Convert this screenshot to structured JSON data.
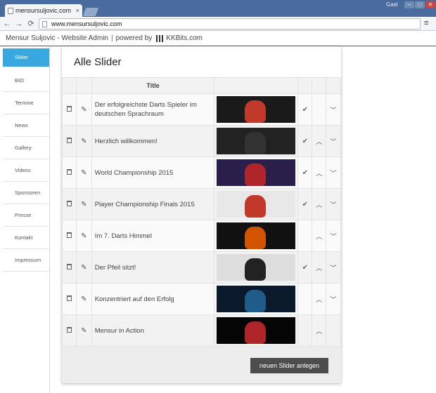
{
  "browser": {
    "tab_title": "mensursuljovic.com",
    "tab_close": "×",
    "user_label": "Gast",
    "url": "www.mensursuljovic.com",
    "back": "←",
    "forward": "→",
    "reload": "⟳",
    "menu": "≡",
    "win_min": "–",
    "win_max": "□",
    "win_close": "✕"
  },
  "site": {
    "name": "Mensur Suljovic - Website Admin",
    "powered": "powered by",
    "brand": "KKBits.com"
  },
  "sidebar": {
    "items": [
      {
        "label": "Slider",
        "active": true
      },
      {
        "label": "BIO"
      },
      {
        "label": "Termine"
      },
      {
        "label": "News"
      },
      {
        "label": "Gallery"
      },
      {
        "label": "Videos"
      },
      {
        "label": "Sponsoren"
      },
      {
        "label": "Presse"
      },
      {
        "label": "Kontakt"
      },
      {
        "label": "Impressum"
      }
    ]
  },
  "panel": {
    "title": "Alle Slider",
    "column_title": "Title",
    "new_button": "neuen Slider anlegen"
  },
  "slides": [
    {
      "title": "Der erfolgreichste Darts Spieler im deutschen Sprachraum",
      "active": true,
      "up": false,
      "down": true
    },
    {
      "title": "Herzlich willkommen!",
      "active": true,
      "up": true,
      "down": true
    },
    {
      "title": "World Championship 2015",
      "active": true,
      "up": true,
      "down": true
    },
    {
      "title": "Player Championship Finals 2015",
      "active": true,
      "up": true,
      "down": true
    },
    {
      "title": "Im 7. Darts Himmel",
      "active": false,
      "up": true,
      "down": true
    },
    {
      "title": "Der Pfeil sitzt!",
      "active": true,
      "up": true,
      "down": true
    },
    {
      "title": "Konzentriert auf den Erfolg",
      "active": false,
      "up": true,
      "down": true
    },
    {
      "title": "Mensur in Action",
      "active": false,
      "up": true,
      "down": false
    }
  ],
  "icons": {
    "check": "✔",
    "up": "︿",
    "down": "﹀",
    "pencil": "✎"
  }
}
